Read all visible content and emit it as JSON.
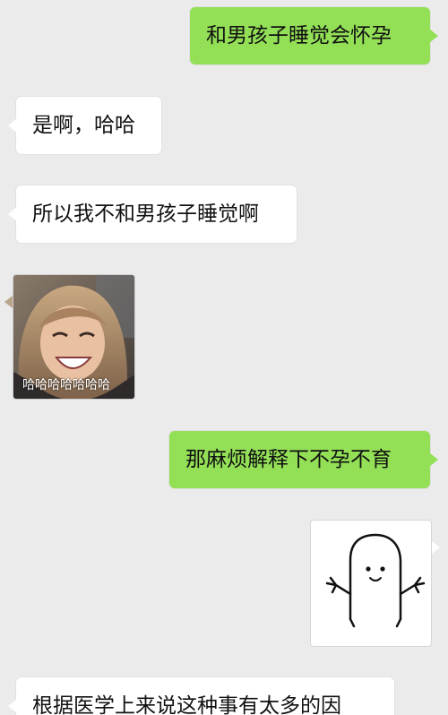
{
  "chat": {
    "messages": [
      {
        "side": "out",
        "text": "和男孩子睡觉会怀孕"
      },
      {
        "side": "in",
        "text": "是啊，哈哈"
      },
      {
        "side": "in",
        "text": "所以我不和男孩子睡觉啊"
      },
      {
        "side": "in",
        "type": "sticker",
        "caption": "哈哈哈哈哈哈哈"
      },
      {
        "side": "out",
        "text": "那麻烦解释下不孕不育"
      },
      {
        "side": "out",
        "type": "sticker",
        "caption": ""
      },
      {
        "side": "in",
        "text": "根据医学上来说这种事有太多的因"
      }
    ]
  },
  "colors": {
    "background": "#ebebeb",
    "incoming_bubble": "#ffffff",
    "outgoing_bubble": "#93e057"
  },
  "icons": {
    "sticker_1": "laughing-girl-photo",
    "sticker_2": "ghost-shrug-icon"
  }
}
